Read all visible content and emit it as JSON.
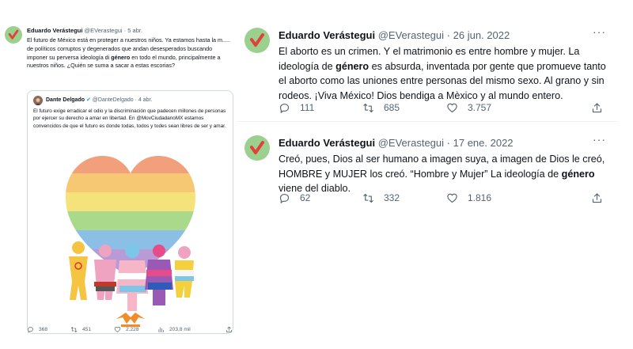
{
  "colors": {
    "brand_green": "#9bd08f",
    "check": "#e0413a",
    "muted": "#536471"
  },
  "left_tweet": {
    "name": "Eduardo Verástegui",
    "handle": "@EVerastegui",
    "separator": "·",
    "date": "5 abr.",
    "text_before": "El futuro de México está en proteger a nuestros niños. Ya estamos hasta la m..... de políticos corruptos y degenerados que andan desesperados buscando imponer su perversa ideología di ",
    "text_bold": "género",
    "text_after": " en todo el mundo, principalmente a nuestros niños. ¿Quién se suma a sacar a estas escorias?",
    "quoted": {
      "name": "Dante Delgado",
      "check": "✔",
      "handle": "@DanteDelgado",
      "separator": "·",
      "date": "4 abr.",
      "text": "El futuro exige erradicar el odio y la discriminación que padecen millones de personas por ejercer su derecho a amar en libertad. En @MovCiudadanoMX estamos convencidos de que el futuro es donde todas, todos y todes sean libres de ser y amar."
    },
    "stats": {
      "replies": "368",
      "retweets": "451",
      "likes": "2.228",
      "views": "203,8 mil"
    }
  },
  "tweets": [
    {
      "name": "Eduardo Verástegui",
      "handle": "@EVerastegui",
      "separator": "·",
      "date": "26 jun. 2022",
      "more": "···",
      "text_before": "El aborto es un crimen. Y el matrimonio es entre hombre y mujer. La ideología de ",
      "text_bold": "género",
      "text_after": " es absurda, inventada por gente que promueve tanto el aborto como las uniones entre personas del mismo sexo. Al grano y sin rodeos. ¡Viva México! Dios bendiga a Mèxico y al mundo entero.",
      "stats": {
        "replies": "111",
        "retweets": "685",
        "likes": "3.757"
      }
    },
    {
      "name": "Eduardo Verástegui",
      "handle": "@EVerastegui",
      "separator": "·",
      "date": "17 ene. 2022",
      "more": "···",
      "text_before": "Creó, pues, Dios al ser humano a imagen suya, a imagen de Dios le creó, HOMBRE y MUJER los creó. “Hombre y Mujer” La ideología de ",
      "text_bold": "género",
      "text_after": " viene del diablo.",
      "stats": {
        "replies": "62",
        "retweets": "332",
        "likes": "1.816"
      }
    }
  ]
}
